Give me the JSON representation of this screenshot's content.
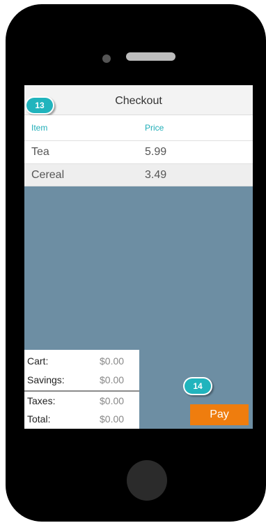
{
  "header": {
    "title": "Checkout",
    "badge": "13"
  },
  "table": {
    "columns": [
      "Item",
      "Price"
    ],
    "rows": [
      {
        "item": "Tea",
        "price": "5.99"
      },
      {
        "item": "Cereal",
        "price": "3.49"
      }
    ]
  },
  "summary": {
    "rows": [
      {
        "label": "Cart:",
        "value": "$0.00"
      },
      {
        "label": "Savings:",
        "value": "$0.00"
      },
      {
        "label": "Taxes:",
        "value": "$0.00"
      },
      {
        "label": "Total:",
        "value": "$0.00"
      }
    ]
  },
  "pay": {
    "label": "Pay",
    "badge": "14"
  },
  "colors": {
    "accent": "#21b4bd",
    "pay_button": "#ef7d0e",
    "background": "#6d8ea3"
  }
}
